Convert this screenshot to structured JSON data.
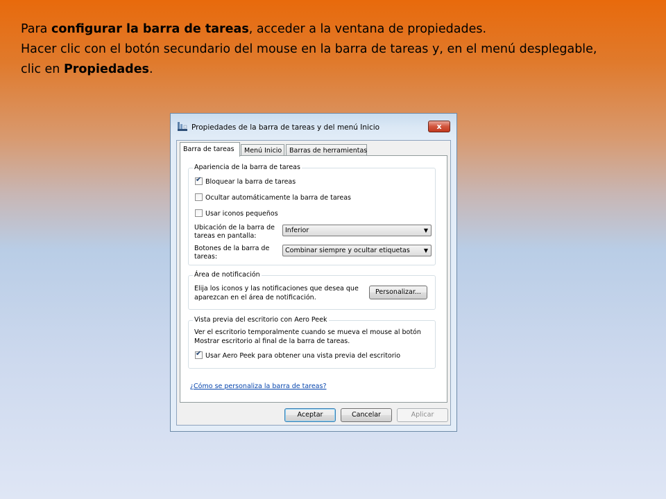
{
  "slide": {
    "line1": {
      "pre": "Para ",
      "bold": "configurar la barra de tareas",
      "post": ", acceder a la ventana de propiedades."
    },
    "line2": "Hacer clic con el botón secundario del mouse en la barra de tareas y, en el menú desplegable,",
    "line3": {
      "pre": "clic en ",
      "bold": "Propiedades",
      "post": "."
    }
  },
  "dialog": {
    "title": "Propiedades de la barra de tareas y del menú Inicio",
    "close_label": "x",
    "tabs": [
      "Barra de tareas",
      "Menú Inicio",
      "Barras de herramientas"
    ],
    "active_tab": 0,
    "appearance": {
      "title": "Apariencia de la barra de tareas",
      "lock": {
        "label": "Bloquear la barra de tareas",
        "checked": true
      },
      "autohide": {
        "label": "Ocultar automáticamente la barra de tareas",
        "checked": false
      },
      "small_icons": {
        "label": "Usar iconos pequeños",
        "checked": false
      },
      "location_label_1": "Ubicación de la barra de",
      "location_label_2": "tareas en pantalla:",
      "location_value": "Inferior",
      "buttons_label_1": "Botones de la barra de",
      "buttons_label_2": "tareas:",
      "buttons_value": "Combinar siempre y ocultar etiquetas"
    },
    "notification": {
      "title": "Área de notificación",
      "text_1": "Elija los iconos y las notificaciones que desea que",
      "text_2": "aparezcan en el área de notificación.",
      "customize_label": "Personalizar..."
    },
    "aero_peek": {
      "title": "Vista previa del escritorio con Aero Peek",
      "text_1": "Ver el escritorio temporalmente cuando se mueva el mouse al botón",
      "text_2": "Mostrar escritorio al final de la barra de tareas.",
      "use": {
        "label": "Usar Aero Peek para obtener una vista previa del escritorio",
        "checked": true
      }
    },
    "help_link": "¿Cómo se personaliza la barra de tareas?",
    "buttons": {
      "ok": "Aceptar",
      "cancel": "Cancelar",
      "apply": "Aplicar"
    }
  }
}
